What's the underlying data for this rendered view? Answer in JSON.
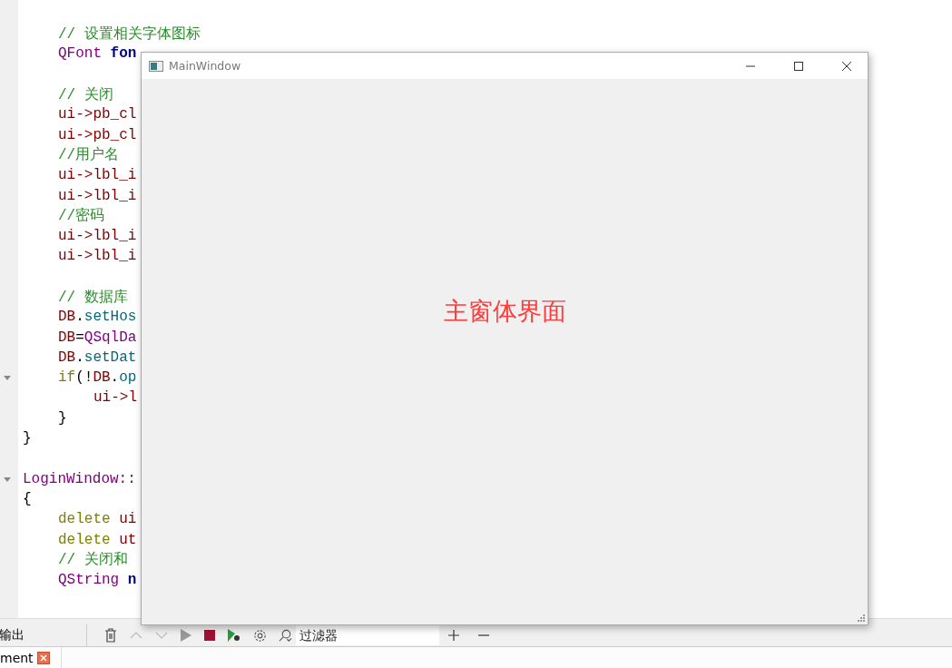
{
  "editor": {
    "lines": [
      {
        "kind": "block",
        "children": [
          {
            "kind": "code",
            "fold": false,
            "parts": [
              {
                "text": "// 设置相关字体图标",
                "kind": "comment"
              }
            ]
          },
          {
            "kind": "code",
            "fold": false,
            "parts": [
              {
                "text": "QFont ",
                "kind": "type"
              },
              {
                "text": "fon",
                "kind": "local"
              }
            ]
          },
          {
            "kind": "blank"
          },
          {
            "kind": "code",
            "fold": false,
            "parts": [
              {
                "text": "// 关闭",
                "kind": "comment"
              }
            ]
          },
          {
            "kind": "code",
            "fold": false,
            "parts": [
              {
                "text": "ui->pb_cl",
                "kind": "member"
              }
            ]
          },
          {
            "kind": "code",
            "fold": false,
            "parts": [
              {
                "text": "ui->pb_cl",
                "kind": "member"
              }
            ]
          },
          {
            "kind": "code",
            "fold": false,
            "parts": [
              {
                "text": "//用户名",
                "kind": "comment"
              }
            ]
          },
          {
            "kind": "code",
            "fold": false,
            "parts": [
              {
                "text": "ui->lbl_i",
                "kind": "member"
              }
            ]
          },
          {
            "kind": "code",
            "fold": false,
            "parts": [
              {
                "text": "ui->lbl_i",
                "kind": "member"
              }
            ]
          },
          {
            "kind": "code",
            "fold": false,
            "parts": [
              {
                "text": "//密码",
                "kind": "comment"
              }
            ]
          },
          {
            "kind": "code",
            "fold": false,
            "parts": [
              {
                "text": "ui->lbl_i",
                "kind": "member"
              }
            ]
          },
          {
            "kind": "code",
            "fold": false,
            "parts": [
              {
                "text": "ui->lbl_i",
                "kind": "member"
              }
            ]
          },
          {
            "kind": "blank"
          },
          {
            "kind": "code",
            "fold": false,
            "parts": [
              {
                "text": "// 数据库",
                "kind": "comment"
              }
            ]
          },
          {
            "kind": "code",
            "fold": false,
            "parts": [
              {
                "text": "DB",
                "kind": "member"
              },
              {
                "text": ".",
                "kind": "plain"
              },
              {
                "text": "setHos",
                "kind": "call"
              }
            ]
          },
          {
            "kind": "code",
            "fold": false,
            "parts": [
              {
                "text": "DB",
                "kind": "member"
              },
              {
                "text": "=",
                "kind": "plain"
              },
              {
                "text": "QSqlDa",
                "kind": "type"
              }
            ]
          },
          {
            "kind": "code",
            "fold": false,
            "parts": [
              {
                "text": "DB",
                "kind": "member"
              },
              {
                "text": ".",
                "kind": "plain"
              },
              {
                "text": "setDat",
                "kind": "call"
              }
            ]
          },
          {
            "kind": "code",
            "fold": true,
            "parts": [
              {
                "text": "if",
                "kind": "keyword"
              },
              {
                "text": "(!",
                "kind": "plain"
              },
              {
                "text": "DB",
                "kind": "member"
              },
              {
                "text": ".",
                "kind": "plain"
              },
              {
                "text": "op",
                "kind": "call"
              }
            ],
            "children": [
              {
                "kind": "code",
                "fold": false,
                "parts": [
                  {
                    "text": "ui->l",
                    "kind": "member"
                  }
                ]
              }
            ]
          },
          {
            "kind": "code",
            "fold": false,
            "parts": [
              {
                "text": "}",
                "kind": "plain"
              }
            ]
          }
        ]
      },
      {
        "kind": "code",
        "fold": false,
        "parts": [
          {
            "text": "}",
            "kind": "plain"
          }
        ]
      },
      {
        "kind": "blank"
      },
      {
        "kind": "code",
        "fold": true,
        "parts": [
          {
            "text": "LoginWindow::",
            "kind": "type"
          }
        ]
      },
      {
        "kind": "code",
        "fold": false,
        "parts": [
          {
            "text": "{",
            "kind": "plain"
          }
        ]
      },
      {
        "kind": "block",
        "children": [
          {
            "kind": "code",
            "fold": false,
            "parts": [
              {
                "text": "delete ",
                "kind": "keyword"
              },
              {
                "text": "ui",
                "kind": "member"
              }
            ]
          },
          {
            "kind": "code",
            "fold": false,
            "parts": [
              {
                "text": "delete ",
                "kind": "keyword"
              },
              {
                "text": "ut",
                "kind": "member"
              }
            ]
          },
          {
            "kind": "code",
            "fold": false,
            "parts": [
              {
                "text": "// 关闭和",
                "kind": "comment"
              }
            ]
          },
          {
            "kind": "code",
            "fold": false,
            "parts": [
              {
                "text": "QString ",
                "kind": "type"
              },
              {
                "text": "n",
                "kind": "local"
              }
            ]
          }
        ]
      }
    ]
  },
  "output_panel": {
    "title": "输出",
    "filter": {
      "placeholder": "过滤器"
    },
    "tab": {
      "label": "ment"
    }
  },
  "window": {
    "title": "MainWindow",
    "label": "主窗体界面"
  }
}
